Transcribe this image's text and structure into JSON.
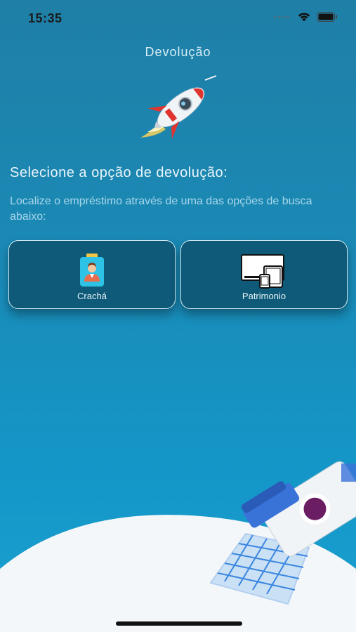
{
  "status_bar": {
    "time": "15:35"
  },
  "header": {
    "title": "Devolução"
  },
  "main": {
    "heading": "Selecione a opção de devolução:",
    "subtext": "Localize o empréstimo através de uma das opções de busca abaixo:",
    "options": [
      {
        "label": "Crachá",
        "icon": "badge-icon"
      },
      {
        "label": "Patrimonio",
        "icon": "devices-icon"
      }
    ]
  },
  "colors": {
    "background_top": "#1f7fa6",
    "background_bottom": "#1aa0d0",
    "card_background": "#0e5a78",
    "rocket_red": "#e0342f"
  }
}
